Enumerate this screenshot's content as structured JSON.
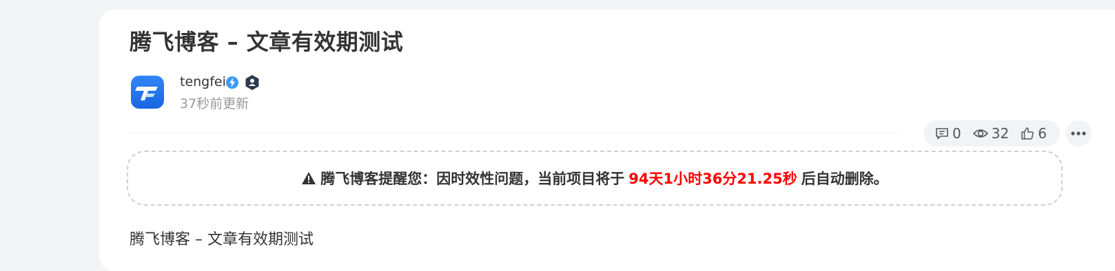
{
  "post": {
    "title": "腾飞博客 – 文章有效期测试",
    "author": {
      "name": "tengfei",
      "updated": "37秒前更新"
    },
    "stats": {
      "comments": "0",
      "views": "32",
      "likes": "6"
    },
    "notice": {
      "prefix": "腾飞博客提醒您：因时效性问题，当前项目将于",
      "countdown": "94天1小时36分21.25秒",
      "suffix": "后自动删除。"
    },
    "body": "腾飞博客 – 文章有效期测试"
  },
  "colors": {
    "accent_blue": "#1a73e8",
    "countdown_red": "#ff0000",
    "page_bg": "#f3f4f6"
  },
  "icons": {
    "avatar": "tengfei-logo-icon",
    "verified": "lightning-verified-icon",
    "user_badge": "user-hexagon-icon",
    "comments": "comment-icon",
    "views": "eye-icon",
    "likes": "thumbs-up-icon",
    "more": "more-dots-icon",
    "warning": "warning-triangle-icon"
  }
}
